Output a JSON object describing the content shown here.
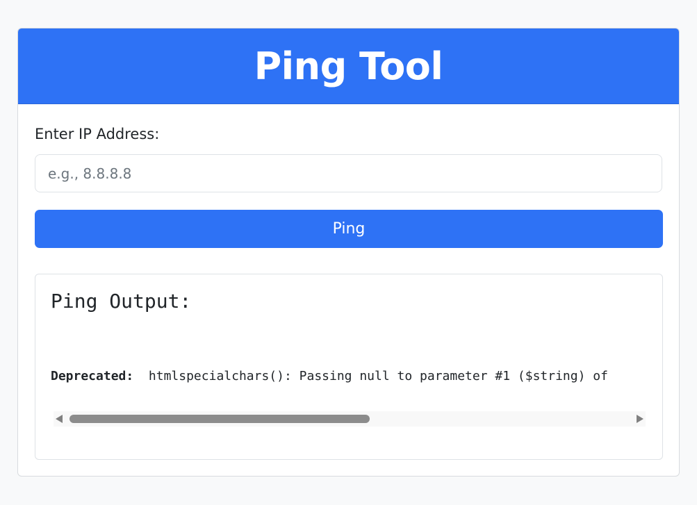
{
  "header": {
    "title": "Ping Tool"
  },
  "form": {
    "label": "Enter IP Address:",
    "input_value": "",
    "input_placeholder": "e.g., 8.8.8.8",
    "button_label": "Ping"
  },
  "output": {
    "title": "Ping Output:",
    "warning_prefix": "Deprecated:",
    "warning_text": "htmlspecialchars(): Passing null to parameter #1 ($string) of"
  },
  "colors": {
    "accent": "#2e72f5",
    "background": "#f8f9fa"
  }
}
